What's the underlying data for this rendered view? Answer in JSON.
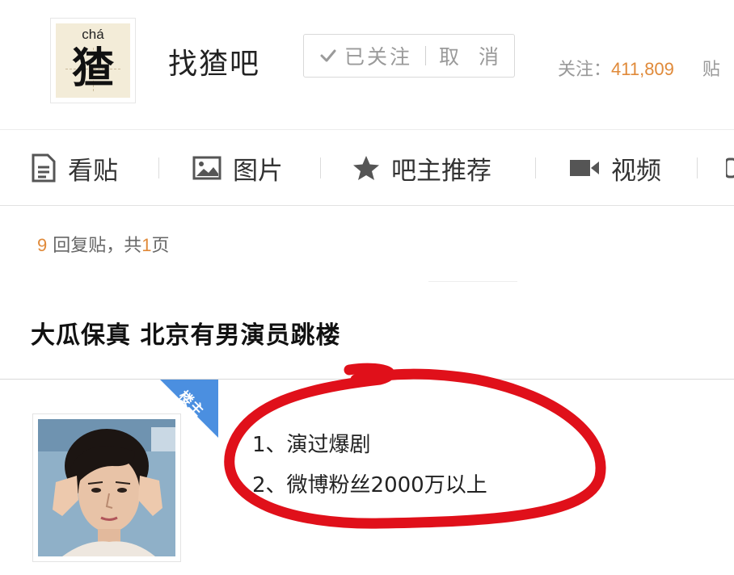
{
  "header": {
    "logo": {
      "pinyin": "chá",
      "character": "猹"
    },
    "forum_name": "找猹吧",
    "follow": {
      "followed_label": "已关注",
      "unfollow_label": "取 消"
    },
    "stats": {
      "follow_label": "关注：",
      "follow_count": "411,809",
      "posts_label_partial": "贴"
    }
  },
  "tabs": [
    {
      "label": "看贴",
      "icon": "document-icon"
    },
    {
      "label": "图片",
      "icon": "image-icon"
    },
    {
      "label": "吧主推荐",
      "icon": "star-icon"
    },
    {
      "label": "视频",
      "icon": "video-camera-icon"
    }
  ],
  "reply_summary": {
    "reply_count": "9",
    "reply_label": "回复贴，共",
    "page_count": "1",
    "page_label": "页"
  },
  "post": {
    "title": "大瓜保真 北京有男演员跳楼",
    "op_badge": "楼主",
    "lines": [
      "1、演过爆剧",
      "2、微博粉丝2000万以上"
    ]
  },
  "colors": {
    "accent_orange": "#e08a3a",
    "badge_blue": "#4b8fe0",
    "annotation_red": "#e0101a",
    "text_gray": "#999999"
  }
}
